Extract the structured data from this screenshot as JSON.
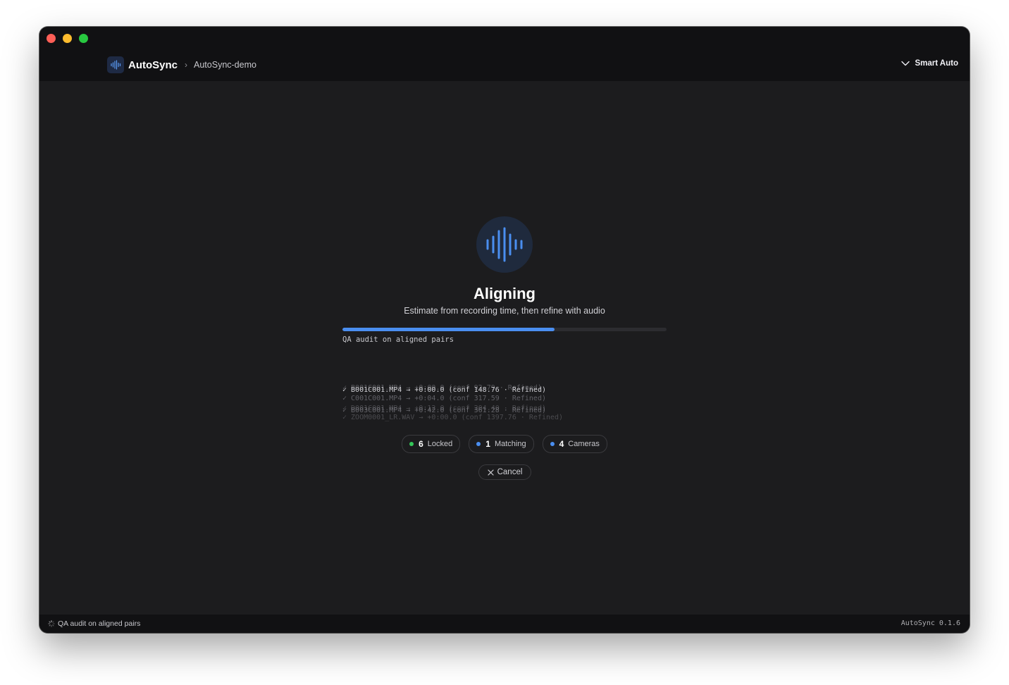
{
  "header": {
    "app_name": "AutoSync",
    "breadcrumb_separator": "›",
    "project_name": "AutoSync-demo",
    "mode_label": "Smart Auto"
  },
  "main": {
    "title": "Aligning",
    "subtitle": "Estimate from recording time, then refine with audio",
    "progress_fraction": 0.655,
    "progress_label": "QA audit on aligned pairs",
    "log_lines": [
      "✓ B001C001.MP4 → +0:00.0 (conf 92.79 · Refined)",
      "✓ B001C001.MP4 → +0:00.0 (conf 148.76 · Refined)",
      "✓ C001C001.MP4 → +0:04.0 (conf 317.59 · Refined)",
      "✓ B003C001.MP4 → +0:42.0 (conf 361.28 · Refined)",
      "✓ D001C001.MP4 → +0:12.0 (conf 204.40 · Refined)",
      "✓ ZOOM0001_LR.WAV → +0:00.0 (conf 1397.76 · Refined)"
    ],
    "stats": [
      {
        "count": "6",
        "label": "Locked",
        "color": "#34c759"
      },
      {
        "count": "1",
        "label": "Matching",
        "color": "#4a8ef0"
      },
      {
        "count": "4",
        "label": "Cameras",
        "color": "#4a8ef0"
      }
    ],
    "cancel_label": "Cancel"
  },
  "statusbar": {
    "status_text": "QA audit on aligned pairs",
    "version": "AutoSync 0.1.6"
  },
  "colors": {
    "accent": "#4a8ef0",
    "locked": "#34c759",
    "window_bg": "#1c1c1e",
    "titlebar_bg": "#111113"
  },
  "icons": {
    "logo": "waveform-icon",
    "hero": "waveform-icon",
    "mode_chevron": "chevron-down-icon",
    "cancel": "close-icon",
    "status": "spinner-icon"
  }
}
